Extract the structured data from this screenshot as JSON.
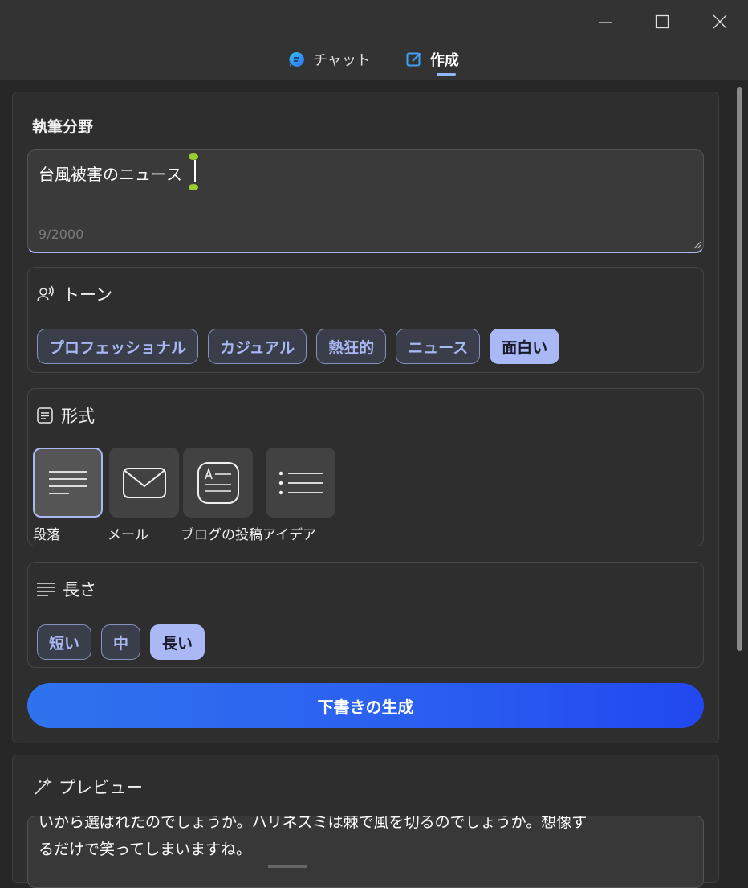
{
  "window": {
    "controls": [
      "minimize-icon",
      "maximize-icon",
      "close-icon"
    ]
  },
  "tabs": [
    {
      "label": "チャット",
      "icon": "chat-icon",
      "active": false
    },
    {
      "label": "作成",
      "icon": "compose-icon",
      "active": true
    }
  ],
  "compose": {
    "section_title": "執筆分野",
    "topic_value": "台風被害のニュース",
    "char_counter": "9/2000"
  },
  "tone": {
    "label": "トーン",
    "icon": "voice-icon",
    "options": [
      "プロフェッショナル",
      "カジュアル",
      "熱狂的",
      "ニュース",
      "面白い"
    ],
    "selected": "面白い"
  },
  "format": {
    "label": "形式",
    "icon": "format-icon",
    "options": [
      {
        "label": "段落",
        "icon": "paragraph-icon"
      },
      {
        "label": "メール",
        "icon": "mail-icon"
      },
      {
        "label": "ブログの投稿",
        "icon": "blog-post-icon"
      },
      {
        "label": "アイデア",
        "icon": "list-icon"
      }
    ],
    "selected": "段落"
  },
  "length": {
    "label": "長さ",
    "icon": "lines-icon",
    "options": [
      "短い",
      "中",
      "長い"
    ],
    "selected": "長い"
  },
  "actions": {
    "generate_label": "下書きの生成"
  },
  "preview": {
    "title": "プレビュー",
    "icon": "magic-wand-icon",
    "text_line1": "いから選ばれたのでしょうか。ハリネズミは棘で風を切るのでしょうか。想像す",
    "text_line2": "るだけで笑ってしまいますね。"
  },
  "colors": {
    "accent": "#a9b8f3",
    "button_gradient_start": "#2f73ee",
    "button_gradient_end": "#2148ef",
    "background": "#272727"
  }
}
